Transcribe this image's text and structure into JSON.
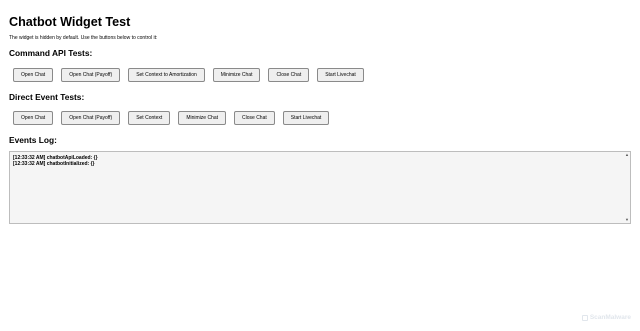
{
  "page": {
    "title": "Chatbot Widget Test",
    "intro": "The widget is hidden by default. Use the buttons below to control it:"
  },
  "command_api": {
    "heading": "Command API Tests:",
    "buttons": [
      "Open Chat",
      "Open Chat (Payoff)",
      "Set Context to Amortization",
      "Minimize Chat",
      "Close Chat",
      "Start Livechat"
    ]
  },
  "direct_event": {
    "heading": "Direct Event Tests:",
    "buttons": [
      "Open Chat",
      "Open Chat (Payoff)",
      "Set Context",
      "Minimize Chat",
      "Close Chat",
      "Start Livechat"
    ]
  },
  "events_log": {
    "heading": "Events Log:",
    "entries": [
      "[12:33:32 AM] chatbotApiLoaded: {}",
      "[12:33:32 AM] chatbotInitialized: {}"
    ],
    "scroll_up_icon": "triangle-up",
    "scroll_down_icon": "triangle-down"
  },
  "watermark": {
    "text": "ScanMalware",
    "icon": "scan-icon"
  }
}
